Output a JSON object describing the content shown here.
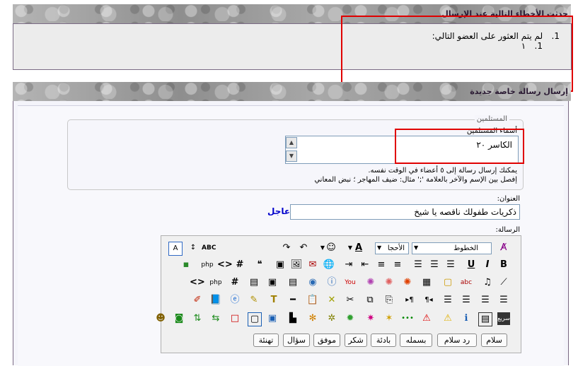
{
  "errors": {
    "header": "حدثت الأخطاء التالية عند الإرسال",
    "items": [
      {
        "num": "1.",
        "text": "لم يتم العثور على العضو التالي:",
        "sub": [
          {
            "num": "1.",
            "text": "١"
          }
        ]
      }
    ]
  },
  "compose": {
    "header": "إرسال رسالة خاصة جديدة",
    "recipients": {
      "legend": "المستلمين",
      "label": "أسماء المستلمين",
      "value": "الكاسر ٢٠",
      "help_line1": "يمكنك إرسال رسالة إلى ٥ أعضاء في الوقت نفسه.",
      "help_line2": "إفصل بين الإسم والآخر بالعلامة ';' مثال: ضيف المهاجر ؛ نبض المعاني"
    },
    "title_label": "العنوان:",
    "title_value": "ذكريات طفولك ناقصه يا شيخ",
    "urgent_label": "عاجل",
    "message_label": "الرسالة:"
  },
  "editor": {
    "font_select": "الخطوط",
    "size_select": "الأحجا",
    "quick_buttons": [
      "سلام",
      "رد سلام",
      "بسمله",
      "بادئة",
      "شكر",
      "موفق",
      "سؤال",
      "تهنئة"
    ]
  },
  "colors": {
    "red_highlight": "#e00000",
    "urgent": "#0000cc",
    "border": "#7a6a84"
  }
}
